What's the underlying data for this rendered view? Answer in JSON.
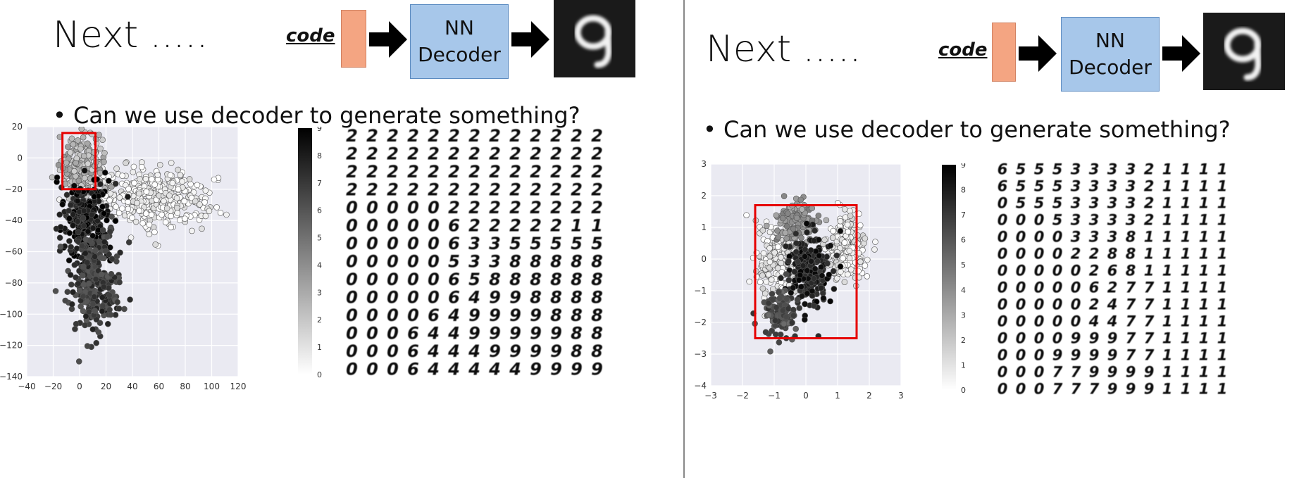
{
  "left": {
    "title": "Next .....",
    "code_label": "code",
    "decoder_line1": "NN",
    "decoder_line2": "Decoder",
    "output_digit": "9",
    "bullet": "• Can we use decoder to generate something?",
    "scatter": {
      "x_ticks": [
        "−40",
        "−20",
        "0",
        "20",
        "40",
        "60",
        "80",
        "100",
        "120"
      ],
      "y_ticks": [
        "20",
        "0",
        "−20",
        "−40",
        "−60",
        "−80",
        "−100",
        "−120",
        "−140"
      ],
      "colorbar_ticks": [
        "9",
        "8",
        "7",
        "6",
        "5",
        "4",
        "3",
        "2",
        "1",
        "0"
      ],
      "xlim": [
        -40,
        120
      ],
      "ylim": [
        -140,
        20
      ],
      "highlight": {
        "x0": -13,
        "x1": 12,
        "y0": -20,
        "y1": 16,
        "color": "#e60000"
      }
    },
    "digit_grid": [
      "2222222222222",
      "2222222222222",
      "2222222222222",
      "2222222222222",
      "0000022222222",
      "0000062222211",
      "0000063355555",
      "0000053388888",
      "0000065888888",
      "0000064998888",
      "0000649999888",
      "0006449999988",
      "0006444999988",
      "0006444449999"
    ]
  },
  "right": {
    "title": "Next .....",
    "code_label": "code",
    "decoder_line1": "NN",
    "decoder_line2": "Decoder",
    "output_digit": "9",
    "bullet": "• Can we use decoder to generate something?",
    "scatter": {
      "x_ticks": [
        "−3",
        "−2",
        "−1",
        "0",
        "1",
        "2",
        "3"
      ],
      "y_ticks": [
        "3",
        "2",
        "1",
        "0",
        "−1",
        "−2",
        "−3",
        "−4"
      ],
      "colorbar_ticks": [
        "9",
        "8",
        "7",
        "6",
        "5",
        "4",
        "3",
        "2",
        "1",
        "0"
      ],
      "xlim": [
        -3,
        3
      ],
      "ylim": [
        -4,
        3
      ],
      "highlight": {
        "x0": -1.6,
        "x1": 1.6,
        "y0": -2.5,
        "y1": 1.7,
        "color": "#e60000"
      }
    },
    "digit_grid": [
      "6555333321111",
      "6555333321111",
      "0555333321111",
      "0005333321111",
      "0000333811111",
      "0000228811111",
      "0000026811111",
      "0000062771111",
      "0000024771111",
      "0000044771111",
      "0000999771111",
      "0009999771111",
      "0007799991111",
      "0007779991111"
    ]
  }
}
